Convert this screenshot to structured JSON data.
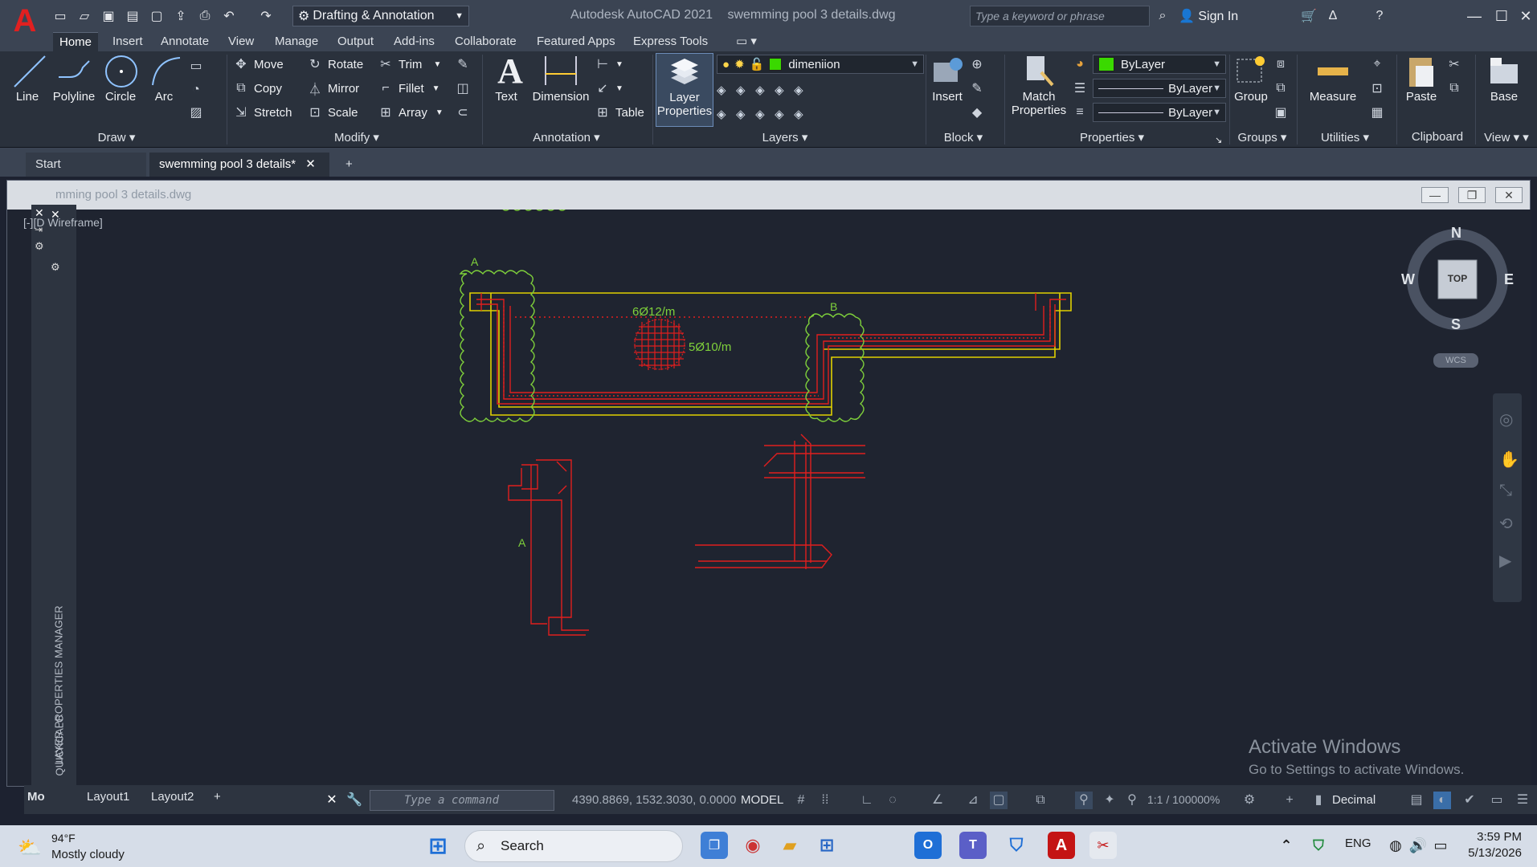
{
  "titlebar": {
    "workspace": "Drafting & Annotation",
    "app_title": "Autodesk AutoCAD 2021",
    "file_title": "swemming pool 3 details.dwg",
    "search_placeholder": "Type a keyword or phrase",
    "signin": "Sign In"
  },
  "ribbon_tabs": [
    "Home",
    "Insert",
    "Annotate",
    "View",
    "Manage",
    "Output",
    "Add-ins",
    "Collaborate",
    "Featured Apps",
    "Express Tools"
  ],
  "draw": {
    "title": "Draw",
    "line": "Line",
    "polyline": "Polyline",
    "circle": "Circle",
    "arc": "Arc"
  },
  "modify": {
    "title": "Modify",
    "move": "Move",
    "rotate": "Rotate",
    "trim": "Trim",
    "copy": "Copy",
    "mirror": "Mirror",
    "fillet": "Fillet",
    "stretch": "Stretch",
    "scale": "Scale",
    "array": "Array"
  },
  "annotation": {
    "title": "Annotation",
    "text": "Text",
    "dimension": "Dimension",
    "table": "Table"
  },
  "layers": {
    "title": "Layers",
    "layer_properties": "Layer Properties",
    "current_layer": "dimeniion",
    "layer_color": "#3ad900"
  },
  "block": {
    "title": "Block",
    "insert": "Insert"
  },
  "properties": {
    "title": "Properties",
    "match": "Match Properties",
    "color": "ByLayer",
    "linetype": "ByLayer",
    "lineweight": "ByLayer",
    "color_swatch": "#3ad900"
  },
  "groups": {
    "title": "Groups",
    "group": "Group"
  },
  "utilities": {
    "title": "Utilities",
    "measure": "Measure"
  },
  "clipboard": {
    "title": "Clipboard",
    "paste": "Paste"
  },
  "view": {
    "title": "View",
    "base": "Base"
  },
  "doc_tabs": {
    "start": "Start",
    "active": "swemming pool 3 details*"
  },
  "drawing": {
    "window_title": "mming pool 3 details.dwg",
    "view_label": "D Wireframe]",
    "label_a_top": "A",
    "label_b": "B",
    "label_a_bottom": "A",
    "annot_1": "6Ø12/m",
    "annot_2": "5Ø10/m"
  },
  "viewcube": {
    "n": "N",
    "s": "S",
    "e": "E",
    "w": "W",
    "top": "TOP",
    "wcs": "WCS"
  },
  "palette": {
    "layer_manager": "LAYER PROPERTIES MANAGER",
    "quickcalc": "QUICKCALC"
  },
  "status": {
    "model_tab": "Mo",
    "layout1": "Layout1",
    "layout2": "Layout2",
    "command_placeholder": "Type a command",
    "coords": "4390.8869, 1532.3030, 0.0000",
    "model": "MODEL",
    "scale": "1:1 / 100000%",
    "units": "Decimal"
  },
  "activate": {
    "heading": "Activate Windows",
    "sub": "Go to Settings to activate Windows."
  },
  "taskbar": {
    "temp": "94°F",
    "condition": "Mostly cloudy",
    "search": "Search",
    "lang": "ENG",
    "time": "3:59 PM",
    "date": "5/13/2026"
  }
}
